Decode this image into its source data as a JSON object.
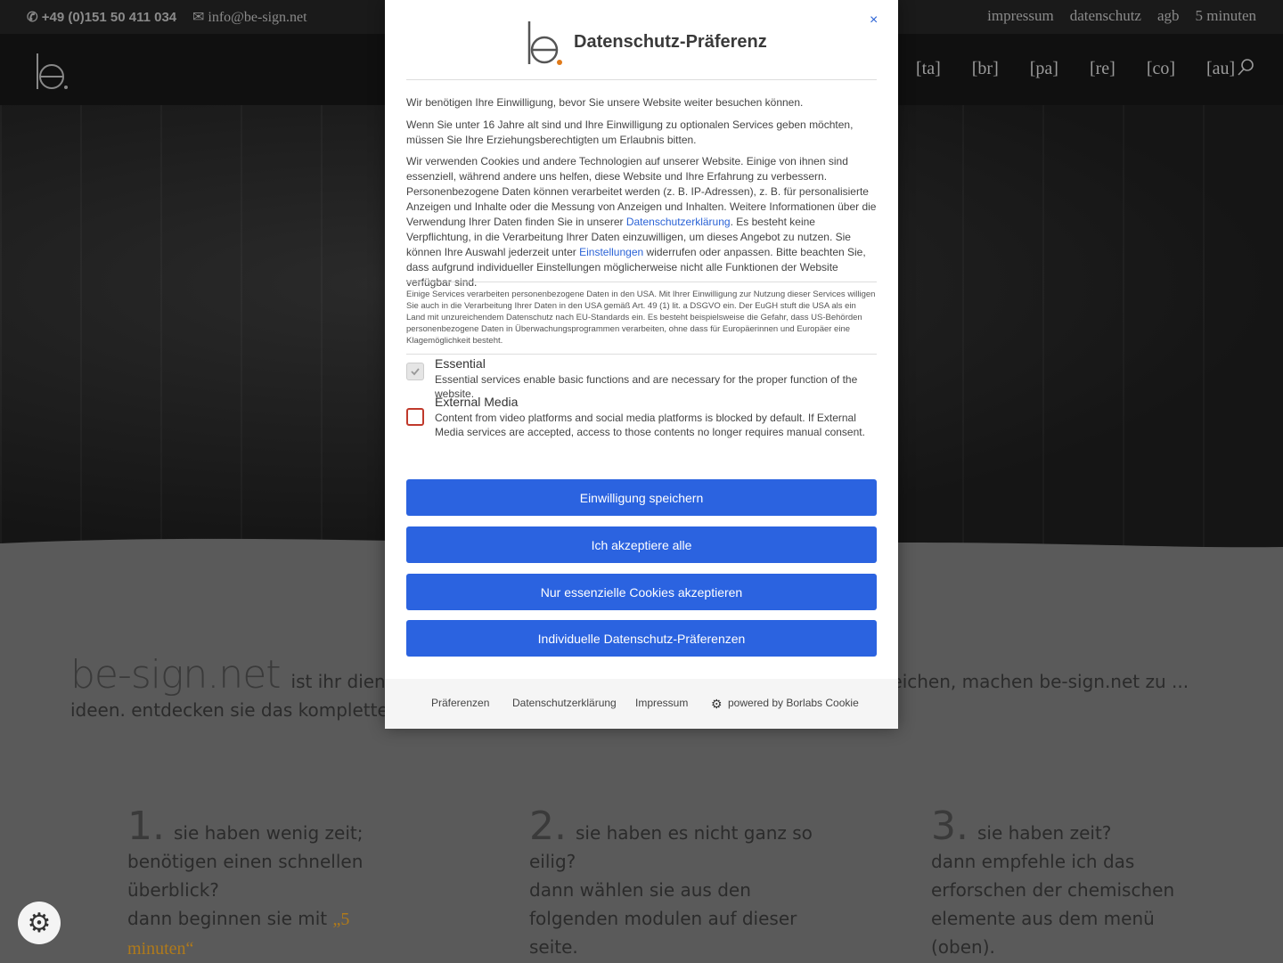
{
  "topbar": {
    "phone": "+49 (0)151 50 411 034",
    "email": "info@be-sign.net",
    "links": [
      "impressum",
      "datenschutz",
      "agb",
      "5 minuten"
    ]
  },
  "nav": {
    "items": [
      "[ta]",
      "[br]",
      "[pa]",
      "[re]",
      "[co]",
      "[au]"
    ]
  },
  "content": {
    "intro_brand": "be-sign.net",
    "intro_text": "ist ihr dienstleister ... erfahrung in den verschiedensten themenbereichen, machen be-sign.net zu ... ideen. entdecken sie das komplette spektrum von be-sign.net in drei schritten:",
    "steps": [
      {
        "num": "1.",
        "line1": "sie haben wenig zeit; benötigen einen schnellen überblick?",
        "line2": "dann beginnen sie mit ",
        "accent": "„5 minuten“"
      },
      {
        "num": "2.",
        "line1": "sie haben es nicht ganz so eilig?",
        "line2": "dann wählen sie aus den folgenden modulen auf dieser seite."
      },
      {
        "num": "3.",
        "line1": "sie haben zeit?",
        "line2": "dann empfehle ich das erforschen der chemischen elemente aus dem menü (oben)."
      }
    ]
  },
  "dialog": {
    "title": "Datenschutz-Präferenz",
    "close": "×",
    "p1": "Wir benötigen Ihre Einwilligung, bevor Sie unsere Website weiter besuchen können.",
    "p2": "Wenn Sie unter 16 Jahre alt sind und Ihre Einwilligung zu optionalen Services geben möchten, müssen Sie Ihre Erziehungsberechtigten um Erlaubnis bitten.",
    "p3a": "Wir verwenden Cookies und andere Technologien auf unserer Website. Einige von ihnen sind essenziell, während andere uns helfen, diese Website und Ihre Erfahrung zu verbessern. Personenbezogene Daten können verarbeitet werden (z. B. IP-Adressen), z. B. für personalisierte Anzeigen und Inhalte oder die Messung von Anzeigen und Inhalten. Weitere Informationen über die Verwendung Ihrer Daten finden Sie in unserer ",
    "p3_link1": "Datenschutzerklärung",
    "p3b": ". Es besteht keine Verpflichtung, in die Verarbeitung Ihrer Daten einzuwilligen, um dieses Angebot zu nutzen. Sie können Ihre Auswahl jederzeit unter ",
    "p3_link2": "Einstellungen",
    "p3c": " widerrufen oder anpassen. Bitte beachten Sie, dass aufgrund individueller Einstellungen möglicherweise nicht alle Funktionen der Website verfügbar sind.",
    "usa_note": "Einige Services verarbeiten personenbezogene Daten in den USA. Mit Ihrer Einwilligung zur Nutzung dieser Services willigen Sie auch in die Verarbeitung Ihrer Daten in den USA gemäß Art. 49 (1) lit. a DSGVO ein. Der EuGH stuft die USA als ein Land mit unzureichendem Datenschutz nach EU-Standards ein. Es besteht beispielsweise die Gefahr, dass US-Behörden personenbezogene Daten in Überwachungsprogrammen verarbeiten, ohne dass für Europäerinnen und Europäer eine Klagemöglichkeit besteht.",
    "services": [
      {
        "title": "Essential",
        "desc": "Essential services enable basic functions and are necessary for the proper function of the website."
      },
      {
        "title": "External Media",
        "desc": "Content from video platforms and social media platforms is blocked by default. If External Media services are accepted, access to those contents no longer requires manual consent."
      }
    ],
    "buttons": [
      "Einwilligung speichern",
      "Ich akzeptiere alle",
      "Nur essenzielle Cookies akzeptieren",
      "Individuelle Datenschutz-Präferenzen"
    ],
    "footer": {
      "prefs": "Präferenzen",
      "privacy": "Datenschutzerklärung",
      "imprint": "Impressum",
      "powered": "powered by Borlabs Cookie"
    }
  }
}
